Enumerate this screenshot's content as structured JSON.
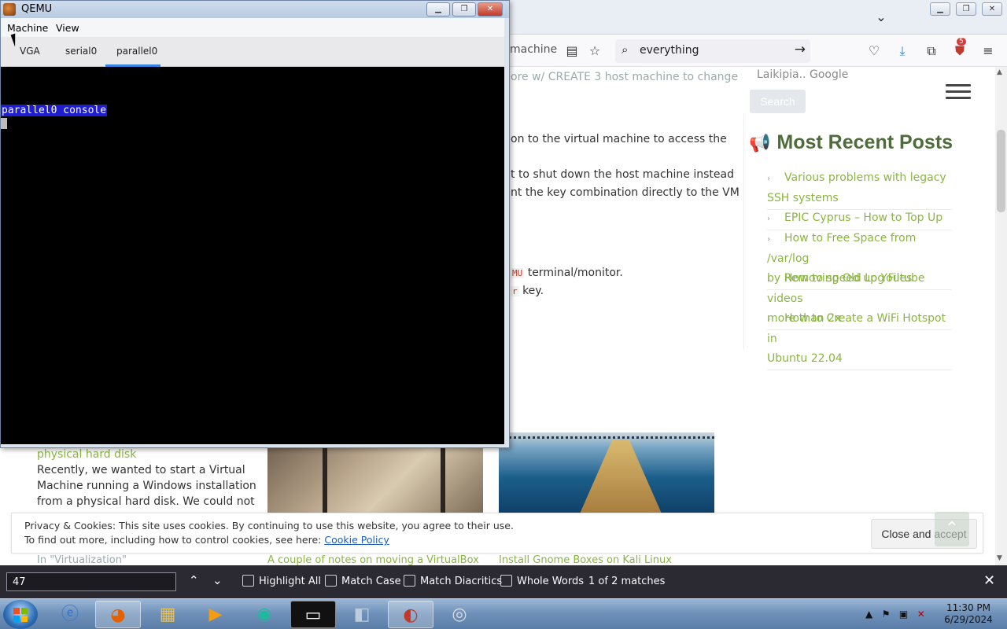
{
  "firefox": {
    "url_tail": "machine",
    "search_value": "everything",
    "extension_badge": "5"
  },
  "article": {
    "faded_line": "ore  w/  CREATE  3 host machine to change",
    "code_create": "CREATE",
    "l1": "on to the virtual machine to access the",
    "l2": "t to shut down the host machine instead",
    "l3": "nt the key combination directly to the VM",
    "code_qemu": "MU",
    "l4": "terminal/monitor.",
    "code_r": "r",
    "l5": "key."
  },
  "sidebar": {
    "search_label": "Laikipia.. Google",
    "search_button": "Search",
    "recent_title": "Most Recent Posts",
    "posts": [
      {
        "line1": "Various problems with legacy",
        "line2": "SSH systems"
      },
      {
        "line1": "EPIC Cyprus – How to Top Up",
        "line2": ""
      },
      {
        "line1": "How to Free Space from /var/log",
        "line2": "by Removing Old Log Files"
      },
      {
        "line1": "How to speed up Youtube videos",
        "line2": "more than 2x"
      },
      {
        "line1": "How to Create a WiFi Hotspot in",
        "line2": "Ubuntu 22.04"
      }
    ]
  },
  "related": {
    "title_tail": "physical hard disk",
    "excerpt": [
      "Recently, we wanted to start a Virtual",
      "Machine running a Windows installation",
      "from a physical hard disk. We could not"
    ],
    "cat_label": "In \"Virtualization\"",
    "caption2": "A couple of notes on moving a VirtualBox",
    "caption3": "Install Gnome Boxes on Kali Linux"
  },
  "cookie": {
    "line1": "Privacy & Cookies: This site uses cookies. By continuing to use this website, you agree to their use.",
    "line2_prefix": "To find out more, including how to control cookies, see here: ",
    "link": "Cookie Policy",
    "close_button": "Close and accept"
  },
  "findbar": {
    "query": "47",
    "highlight_all": "Highlight All",
    "match_case": "Match Case",
    "match_diacritics": "Match Diacritics",
    "whole_words": "Whole Words",
    "matches": "1 of 2 matches"
  },
  "qemu": {
    "title": "QEMU",
    "menus": [
      "Machine",
      "View"
    ],
    "tabs": [
      "VGA",
      "serial0",
      "parallel0"
    ],
    "active_tab": "parallel0",
    "console_text": "parallel0 console"
  },
  "taskbar": {
    "time": "11:30 PM",
    "date": "6/29/2024"
  },
  "colors": {
    "accent_green": "#8ab543",
    "qemu_selection": "#1e1ed0",
    "findbar_bg": "#2b2a33",
    "tab_underline": "#3584e4"
  }
}
